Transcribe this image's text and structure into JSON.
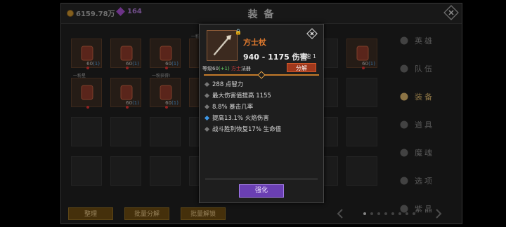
{
  "header": {
    "gold": "6159.78万",
    "gems": "164",
    "title": "装 备"
  },
  "grid": {
    "slots": [
      {
        "lvl": "60",
        "plus": "(1)",
        "tag": ""
      },
      {
        "lvl": "60",
        "plus": "(1)",
        "tag": ""
      },
      {
        "lvl": "60",
        "plus": "(1)",
        "tag": ""
      },
      {
        "lvl": "",
        "plus": "",
        "tag": "一粉星"
      },
      {
        "lvl": "60",
        "plus": "(1)",
        "tag": ""
      },
      {
        "lvl": "",
        "plus": "",
        "tag": "一粉星"
      },
      {
        "lvl": "60",
        "plus": "(1)",
        "tag": ""
      },
      {
        "lvl": "60",
        "plus": "(1)",
        "tag": "一粉获得!"
      },
      {
        "lvl": "59",
        "plus": "(1)",
        "tag": ""
      },
      {
        "lvl": "60",
        "plus": "(1)",
        "tag": "一粉获得!"
      },
      {
        "lvl": "59",
        "plus": "(1)",
        "tag": ""
      }
    ]
  },
  "buttons": {
    "organize": "整理",
    "bulk_decompose": "批量分解",
    "bulk_unlock": "批量解锁"
  },
  "sidebar": {
    "items": [
      {
        "label": "英雄",
        "icon": "hero-icon"
      },
      {
        "label": "队伍",
        "icon": "flag-icon"
      },
      {
        "label": "装备",
        "icon": "helmet-icon",
        "active": true
      },
      {
        "label": "道具",
        "icon": "items-icon"
      },
      {
        "label": "魔魂",
        "icon": "flame-icon"
      },
      {
        "label": "选项",
        "icon": "gear-icon"
      },
      {
        "label": "紫晶",
        "icon": "crystal-icon"
      }
    ]
  },
  "popup": {
    "name": "方士杖",
    "damage": "940 - 1175 伤害",
    "speed": "攻速 1",
    "req_prefix": "等级60",
    "req_plus": "(+1)",
    "req_class_red": "方士",
    "req_class": "法器",
    "sell": "分解",
    "stats": [
      {
        "text": "288 点智力",
        "highlight": false
      },
      {
        "text": "最大伤害值提高 1155",
        "highlight": false
      },
      {
        "text": "8.8% 暴击几率",
        "highlight": false
      },
      {
        "text": "提高13.1% 火焰伤害",
        "highlight": true
      },
      {
        "text": "战斗胜利恢复17% 生命值",
        "highlight": false
      }
    ],
    "enhance": "强化"
  },
  "colors": {
    "accent_orange": "#e07a2e",
    "accent_gold": "#d7b36a",
    "enhance_purple": "#6a3fb3",
    "sell_red": "#a0381c"
  }
}
